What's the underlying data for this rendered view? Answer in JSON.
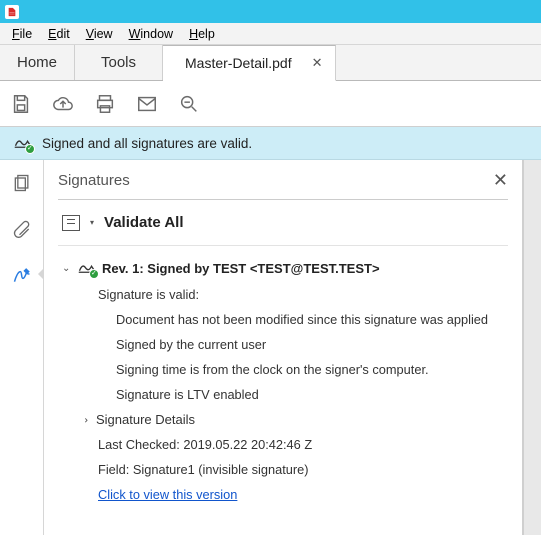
{
  "menu": {
    "file": "File",
    "edit": "Edit",
    "view": "View",
    "window": "Window",
    "help": "Help"
  },
  "tabs": {
    "home": "Home",
    "tools": "Tools",
    "document": "Master-Detail.pdf"
  },
  "status": {
    "message": "Signed and all signatures are valid."
  },
  "panel": {
    "title": "Signatures",
    "validate_all": "Validate All",
    "rev_line": "Rev. 1: Signed by TEST <TEST@TEST.TEST>",
    "sig_valid": "Signature is valid:",
    "d1": "Document has not been modified since this signature was applied",
    "d2": "Signed by the current user",
    "d3": "Signing time is from the clock on the signer's computer.",
    "d4": "Signature is LTV enabled",
    "sig_details": "Signature Details",
    "last_checked": "Last Checked: 2019.05.22 20:42:46 Z",
    "field": "Field: Signature1 (invisible signature)",
    "click_link": "Click to view this version"
  }
}
